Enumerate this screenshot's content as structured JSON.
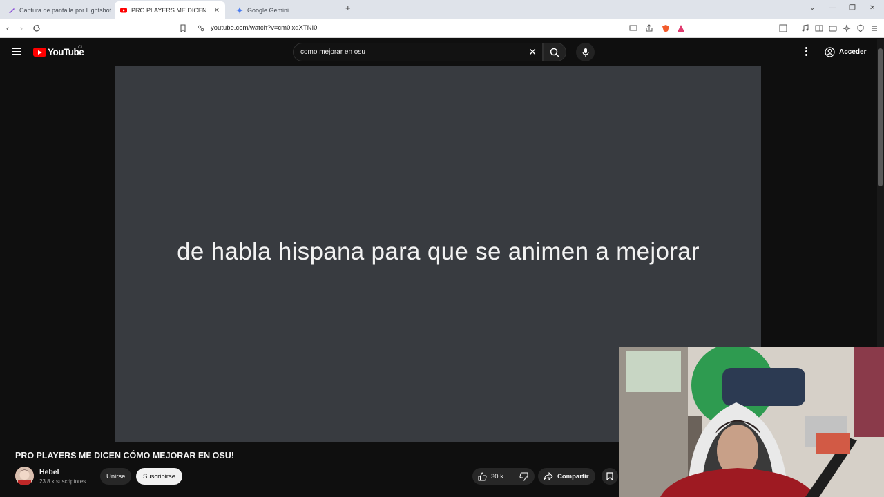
{
  "browser": {
    "tabs": [
      {
        "label": "Captura de pantalla por Lightshot",
        "icon": "feather-icon"
      },
      {
        "label": "PRO PLAYERS ME DICEN CÓMO MEJORAR EN OSU!",
        "icon": "youtube-icon",
        "active": true
      },
      {
        "label": "Google Gemini",
        "icon": "gemini-icon"
      }
    ],
    "url": "youtube.com/watch?v=cm0ixqXTNI0"
  },
  "header": {
    "logo": "YouTube",
    "region": "CL",
    "search_value": "como mejorar en osu",
    "signin_label": "Acceder"
  },
  "video": {
    "subtitle": "de habla hispana para que se animen a mejorar",
    "title": "PRO PLAYERS ME DICEN CÓMO MEJORAR EN OSU!"
  },
  "channel": {
    "name": "Hebel",
    "subscribers": "23.8 k suscriptores",
    "join_label": "Unirse",
    "subscribe_label": "Suscribirse"
  },
  "actions": {
    "likes": "30 k",
    "share_label": "Compartir"
  },
  "colors": {
    "brand": "#ff0000",
    "background": "#0f0f0f",
    "video_bg": "#383b40"
  }
}
